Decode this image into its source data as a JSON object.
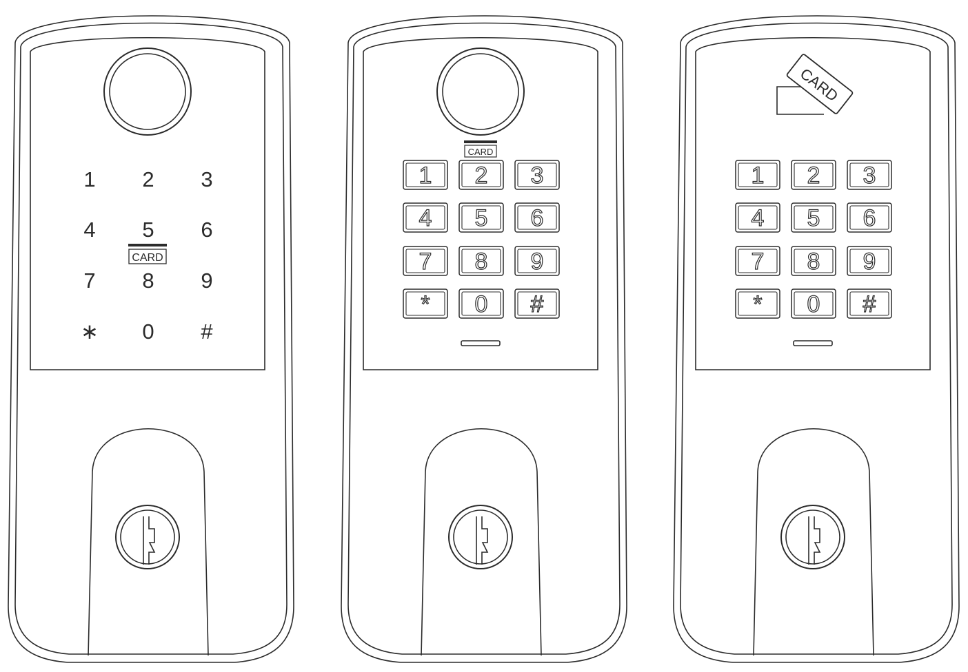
{
  "locks": [
    {
      "id": "touch-panel-fingerprint",
      "has_fingerprint": true,
      "keypad_style": "touch",
      "keys": [
        "1",
        "2",
        "3",
        "4",
        "5",
        "6",
        "7",
        "8",
        "9",
        "∗",
        "0",
        "#"
      ],
      "card_label": "CARD",
      "card_label_style": "badge"
    },
    {
      "id": "button-keypad-fingerprint",
      "has_fingerprint": true,
      "keypad_style": "buttons",
      "keys": [
        "1",
        "2",
        "3",
        "4",
        "5",
        "6",
        "7",
        "8",
        "9",
        "*",
        "0",
        "#"
      ],
      "card_label": "CARD",
      "card_label_style": "badge",
      "indicator_light": true
    },
    {
      "id": "button-keypad-card",
      "has_fingerprint": false,
      "keypad_style": "buttons",
      "keys": [
        "1",
        "2",
        "3",
        "4",
        "5",
        "6",
        "7",
        "8",
        "9",
        "*",
        "0",
        "#"
      ],
      "card_label": "CARD",
      "card_label_style": "tilted-card",
      "indicator_light": true
    }
  ],
  "colors": {
    "line": "#2b2b2b",
    "background": "#ffffff"
  }
}
